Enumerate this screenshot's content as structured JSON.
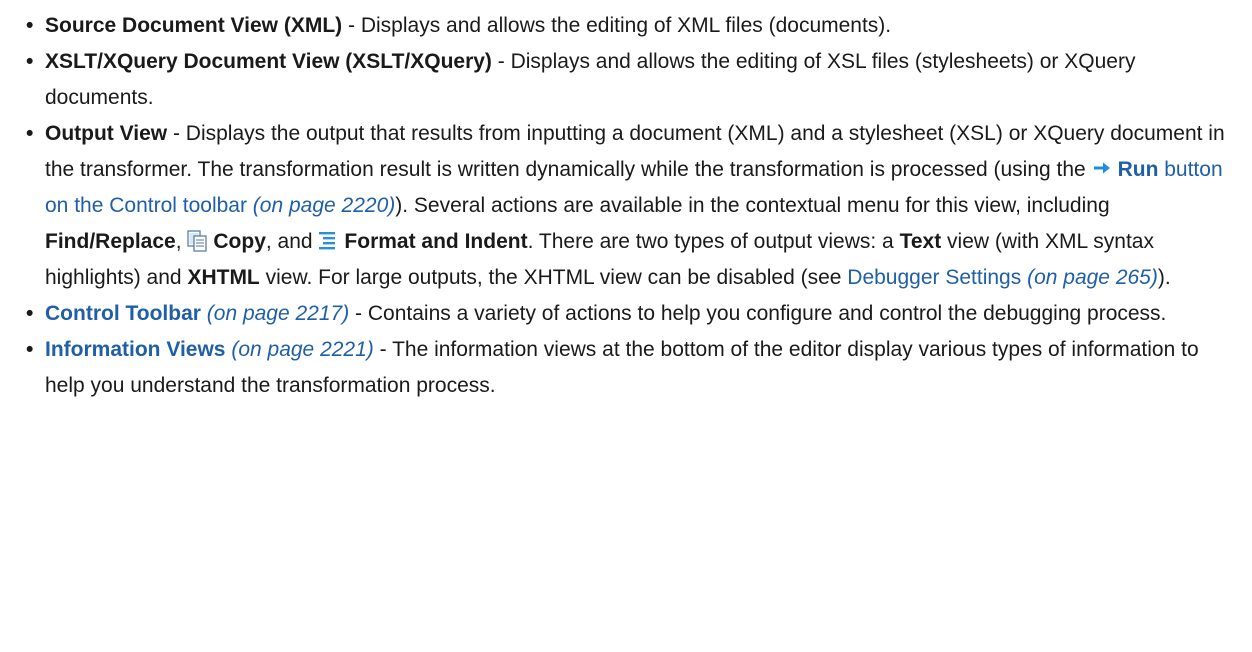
{
  "items": [
    {
      "title": "Source Document View (XML)",
      "text": " - Displays and allows the editing of XML files (documents)."
    },
    {
      "title": "XSLT/XQuery Document View (XSLT/XQuery)",
      "text": " - Displays and allows the editing of XSL files (stylesheets) or XQuery documents."
    },
    {
      "title": "Output View",
      "t1": " - Displays the output that results from inputting a document (XML) and a stylesheet (XSL) or XQuery document in the transformer. The transformation result is written dynamically while the transformation is processed (using the ",
      "run_label": "Run",
      "run_link_text": " button on the Control toolbar ",
      "run_ref": "(on page 2220)",
      "t2": "). Several actions are available in the contextual menu for this view, including ",
      "find_replace": "Find/Replace",
      "t3": ", ",
      "copy": "Copy",
      "t4": ", and ",
      "format_indent": "Format and Indent",
      "t5": ". There are two types of output views: a ",
      "text_view": "Text",
      "t6": " view (with XML syntax highlights) and ",
      "xhtml": "XHTML",
      "t7": " view. For large outputs, the XHTML view can be disabled (see ",
      "debugger_link": "Debugger Settings",
      "debugger_ref": "(on page 265)",
      "t8": ")."
    },
    {
      "title": "Control Toolbar",
      "ref": "(on page 2217)",
      "text": " - Contains a variety of actions to help you configure and control the debugging process."
    },
    {
      "title": "Information Views",
      "ref": "(on page 2221)",
      "text": " - The information views at the bottom of the editor display various types of information to help you understand the transformation process."
    }
  ],
  "bullet_char": "•",
  "icons": {
    "run": "run-arrow-icon",
    "copy": "copy-icon",
    "format": "format-indent-icon"
  },
  "colors": {
    "link": "#1f5fa8",
    "text": "#1a1a1a",
    "run_icon": "#1e8fe0"
  }
}
